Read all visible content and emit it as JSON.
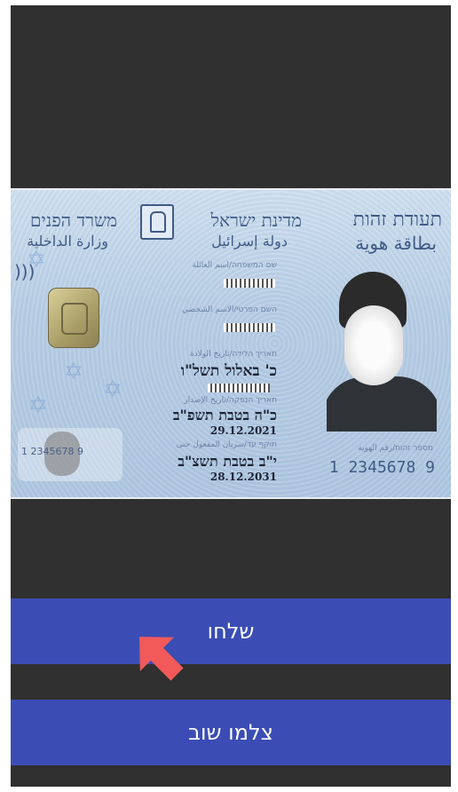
{
  "card": {
    "title_he": "תעודת זהות",
    "title_ar": "بطاقة هوية",
    "state_he": "מדינת ישראל",
    "state_ar": "دولة إسرائيل",
    "ministry_he": "משרד הפנים",
    "ministry_ar": "وزارة الداخلية",
    "label_family": "שם המשפחה/اسم العائلة",
    "label_given": "השם הפרטי/الاسم الشخصي",
    "label_birth": "תאריך הלידה/تاريخ الولادة",
    "birth_date_he": "כ' באלול תשל\"ו",
    "label_issue": "תאריך הנפקה/تاريخ الإصدار",
    "issue_date_he": "כ\"ה בטבת תשפ\"ב",
    "issue_date": "29.12.2021",
    "label_expiry": "תוקף עד/سريان المفعول حتى",
    "expiry_date_he": "י\"ב בטבת תשצ\"ב",
    "expiry_date": "28.12.2031",
    "label_id": "מספר זהות/رقم الهوية",
    "id_number": "1 2345678 9",
    "ghost_id": "1 2345678 9"
  },
  "buttons": {
    "send_label": "שלחו",
    "retake_label": "צלמו שוב"
  },
  "colors": {
    "background": "#303030",
    "button": "#3b4db4",
    "pointer": "#f25a5a"
  }
}
